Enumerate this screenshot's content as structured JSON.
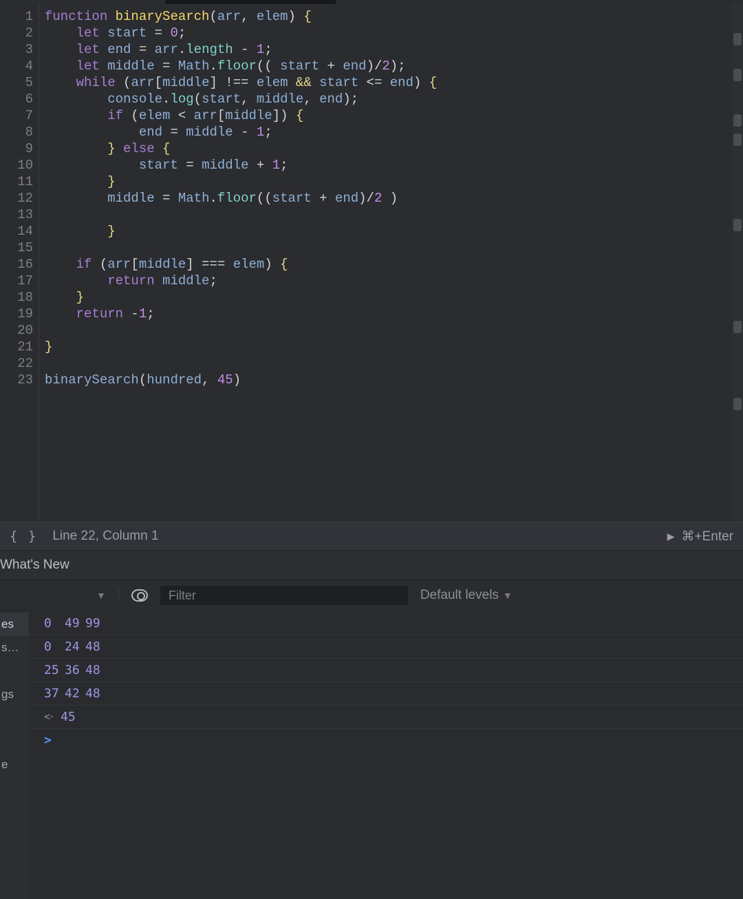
{
  "editor": {
    "lines": [
      {
        "n": 1,
        "tokens": [
          [
            "kw",
            "function "
          ],
          [
            "fn",
            "binarySearch"
          ],
          [
            "op",
            "("
          ],
          [
            "id",
            "arr"
          ],
          [
            "op",
            ", "
          ],
          [
            "id",
            "elem"
          ],
          [
            "op",
            ") "
          ],
          [
            "br",
            "{"
          ]
        ]
      },
      {
        "n": 2,
        "tokens": [
          [
            "op",
            "    "
          ],
          [
            "kw",
            "let "
          ],
          [
            "id",
            "start"
          ],
          [
            "op",
            " = "
          ],
          [
            "num",
            "0"
          ],
          [
            "op",
            ";"
          ]
        ]
      },
      {
        "n": 3,
        "tokens": [
          [
            "op",
            "    "
          ],
          [
            "kw",
            "let "
          ],
          [
            "id",
            "end"
          ],
          [
            "op",
            " = "
          ],
          [
            "id",
            "arr"
          ],
          [
            "op",
            "."
          ],
          [
            "prop",
            "length"
          ],
          [
            "op",
            " - "
          ],
          [
            "num",
            "1"
          ],
          [
            "op",
            ";"
          ]
        ]
      },
      {
        "n": 4,
        "tokens": [
          [
            "op",
            "    "
          ],
          [
            "kw",
            "let "
          ],
          [
            "id",
            "middle"
          ],
          [
            "op",
            " = "
          ],
          [
            "obj",
            "Math"
          ],
          [
            "op",
            "."
          ],
          [
            "prop",
            "floor"
          ],
          [
            "op",
            "(( "
          ],
          [
            "id",
            "start"
          ],
          [
            "op",
            " + "
          ],
          [
            "id",
            "end"
          ],
          [
            "op",
            ")/"
          ],
          [
            "num",
            "2"
          ],
          [
            "op",
            ");"
          ]
        ]
      },
      {
        "n": 5,
        "tokens": [
          [
            "op",
            "    "
          ],
          [
            "kw",
            "while"
          ],
          [
            "op",
            " ("
          ],
          [
            "id",
            "arr"
          ],
          [
            "op",
            "["
          ],
          [
            "id",
            "middle"
          ],
          [
            "op",
            "] !== "
          ],
          [
            "id",
            "elem"
          ],
          [
            "op",
            " "
          ],
          [
            "br",
            "&&"
          ],
          [
            "op",
            " "
          ],
          [
            "id",
            "start"
          ],
          [
            "op",
            " <= "
          ],
          [
            "id",
            "end"
          ],
          [
            "op",
            ") "
          ],
          [
            "br",
            "{"
          ]
        ]
      },
      {
        "n": 6,
        "tokens": [
          [
            "op",
            "        "
          ],
          [
            "obj",
            "console"
          ],
          [
            "op",
            "."
          ],
          [
            "prop",
            "log"
          ],
          [
            "op",
            "("
          ],
          [
            "id",
            "start"
          ],
          [
            "op",
            ", "
          ],
          [
            "id",
            "middle"
          ],
          [
            "op",
            ", "
          ],
          [
            "id",
            "end"
          ],
          [
            "op",
            ");"
          ]
        ]
      },
      {
        "n": 7,
        "tokens": [
          [
            "op",
            "        "
          ],
          [
            "kw",
            "if"
          ],
          [
            "op",
            " ("
          ],
          [
            "id",
            "elem"
          ],
          [
            "op",
            " < "
          ],
          [
            "id",
            "arr"
          ],
          [
            "op",
            "["
          ],
          [
            "id",
            "middle"
          ],
          [
            "op",
            "]) "
          ],
          [
            "br",
            "{"
          ]
        ]
      },
      {
        "n": 8,
        "tokens": [
          [
            "op",
            "            "
          ],
          [
            "id",
            "end"
          ],
          [
            "op",
            " = "
          ],
          [
            "id",
            "middle"
          ],
          [
            "op",
            " - "
          ],
          [
            "num",
            "1"
          ],
          [
            "op",
            ";"
          ]
        ]
      },
      {
        "n": 9,
        "tokens": [
          [
            "op",
            "        "
          ],
          [
            "br",
            "}"
          ],
          [
            "op",
            " "
          ],
          [
            "kw",
            "else"
          ],
          [
            "op",
            " "
          ],
          [
            "br",
            "{"
          ]
        ]
      },
      {
        "n": 10,
        "tokens": [
          [
            "op",
            "            "
          ],
          [
            "id",
            "start"
          ],
          [
            "op",
            " = "
          ],
          [
            "id",
            "middle"
          ],
          [
            "op",
            " + "
          ],
          [
            "num",
            "1"
          ],
          [
            "op",
            ";"
          ]
        ]
      },
      {
        "n": 11,
        "tokens": [
          [
            "op",
            "        "
          ],
          [
            "br",
            "}"
          ]
        ]
      },
      {
        "n": 12,
        "tokens": [
          [
            "op",
            "        "
          ],
          [
            "id",
            "middle"
          ],
          [
            "op",
            " = "
          ],
          [
            "obj",
            "Math"
          ],
          [
            "op",
            "."
          ],
          [
            "prop",
            "floor"
          ],
          [
            "op",
            "(("
          ],
          [
            "id",
            "start"
          ],
          [
            "op",
            " + "
          ],
          [
            "id",
            "end"
          ],
          [
            "op",
            ")/"
          ],
          [
            "num",
            "2"
          ],
          [
            "op",
            " )"
          ]
        ]
      },
      {
        "n": 13,
        "tokens": []
      },
      {
        "n": 14,
        "tokens": [
          [
            "op",
            "        "
          ],
          [
            "br",
            "}"
          ]
        ]
      },
      {
        "n": 15,
        "tokens": []
      },
      {
        "n": 16,
        "tokens": [
          [
            "op",
            "    "
          ],
          [
            "kw",
            "if"
          ],
          [
            "op",
            " ("
          ],
          [
            "id",
            "arr"
          ],
          [
            "op",
            "["
          ],
          [
            "id",
            "middle"
          ],
          [
            "op",
            "] === "
          ],
          [
            "id",
            "elem"
          ],
          [
            "op",
            ") "
          ],
          [
            "br",
            "{"
          ]
        ]
      },
      {
        "n": 17,
        "tokens": [
          [
            "op",
            "        "
          ],
          [
            "kw",
            "return "
          ],
          [
            "id",
            "middle"
          ],
          [
            "op",
            ";"
          ]
        ]
      },
      {
        "n": 18,
        "tokens": [
          [
            "op",
            "    "
          ],
          [
            "br",
            "}"
          ]
        ]
      },
      {
        "n": 19,
        "tokens": [
          [
            "op",
            "    "
          ],
          [
            "kw",
            "return"
          ],
          [
            "op",
            " -"
          ],
          [
            "num",
            "1"
          ],
          [
            "op",
            ";"
          ]
        ]
      },
      {
        "n": 20,
        "tokens": []
      },
      {
        "n": 21,
        "tokens": [
          [
            "br",
            "}"
          ]
        ]
      },
      {
        "n": 22,
        "tokens": []
      },
      {
        "n": 23,
        "tokens": [
          [
            "id",
            "binarySearch"
          ],
          [
            "op",
            "("
          ],
          [
            "id",
            "hundred"
          ],
          [
            "op",
            ", "
          ],
          [
            "num",
            "45"
          ],
          [
            "op",
            ")"
          ]
        ]
      }
    ],
    "minimap_marks": [
      42,
      94,
      160,
      188,
      312,
      460,
      572
    ]
  },
  "status": {
    "braces": "{ }",
    "cursor_text": "Line 22, Column 1",
    "run_label": "⌘+Enter"
  },
  "whatsnew": {
    "label": "What's New"
  },
  "console_toolbar": {
    "filter_placeholder": "Filter",
    "levels_label": "Default levels"
  },
  "side_tabs": [
    "es",
    "s…",
    "",
    "gs",
    "",
    "",
    "e"
  ],
  "console": {
    "logs": [
      [
        0,
        49,
        99
      ],
      [
        0,
        24,
        48
      ],
      [
        25,
        36,
        48
      ],
      [
        37,
        42,
        48
      ]
    ],
    "return_value": 45
  }
}
